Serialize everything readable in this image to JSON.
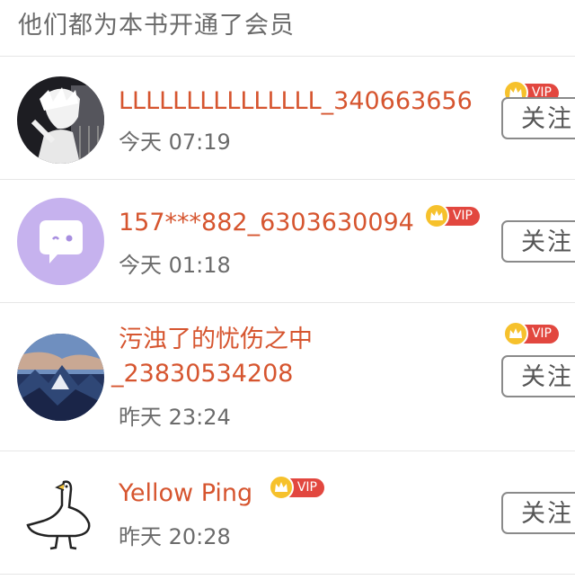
{
  "header": {
    "title": "他们都为本书开通了会员"
  },
  "badge_label": "VIP",
  "follow_label": "关注",
  "colors": {
    "username": "#d6552f",
    "vip_tag": "#e2473f",
    "vip_crown": "#f6c12c",
    "timestamp": "#6b6b6b"
  },
  "members": [
    {
      "username": "LLLLLLLLLLLLLLL_340663656",
      "time": "今天 07:19",
      "avatar_icon": "anime-boy-avatar-icon"
    },
    {
      "username": "157***882_6303630094",
      "time": "今天 01:18",
      "avatar_icon": "chat-bubble-avatar-icon"
    },
    {
      "username_line1": "污浊了的忧伤之中",
      "username_line2": "_23830534208",
      "time": "昨天 23:24",
      "avatar_icon": "mountain-landscape-avatar-icon"
    },
    {
      "username": "Yellow Ping",
      "time": "昨天 20:28",
      "avatar_icon": "goose-avatar-icon"
    }
  ]
}
